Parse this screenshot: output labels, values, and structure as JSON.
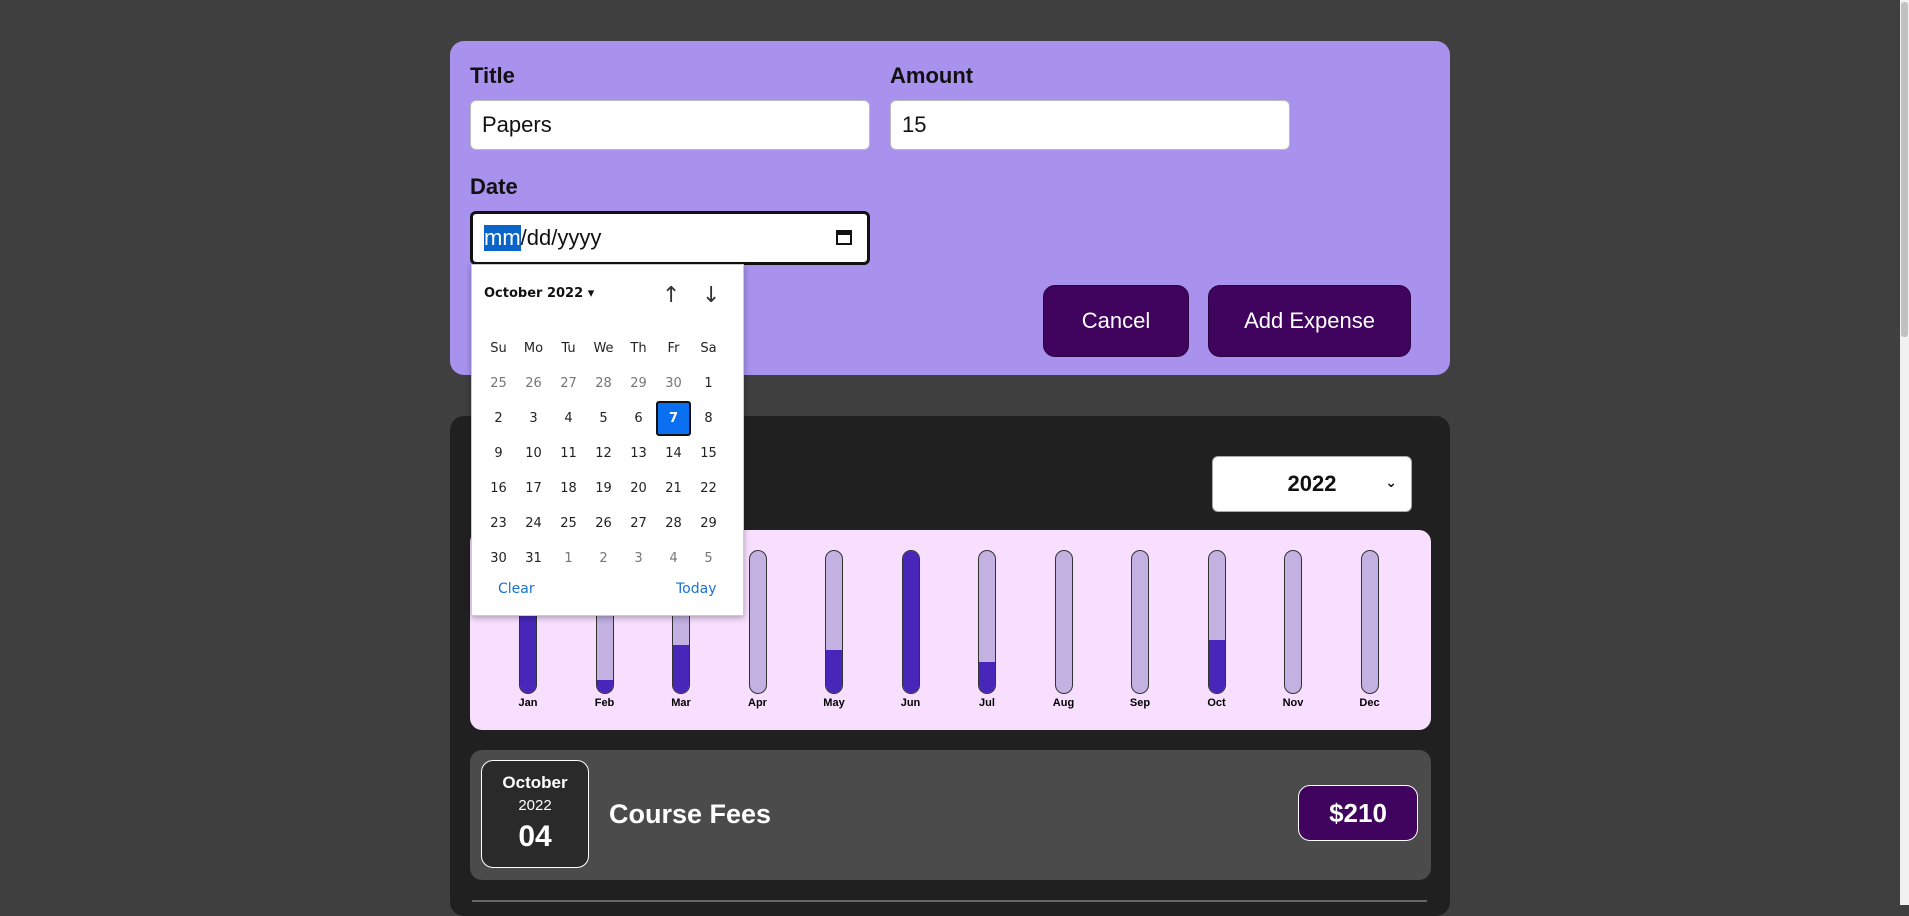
{
  "form": {
    "title_label": "Title",
    "title_value": "Papers",
    "amount_label": "Amount",
    "amount_value": "15",
    "date_label": "Date",
    "date_mm": "mm",
    "date_rest": "/dd/yyyy",
    "cancel_label": "Cancel",
    "add_label": "Add Expense"
  },
  "calendar": {
    "month_label": "October 2022",
    "weekdays": [
      "Su",
      "Mo",
      "Tu",
      "We",
      "Th",
      "Fr",
      "Sa"
    ],
    "weeks": [
      [
        "25",
        "26",
        "27",
        "28",
        "29",
        "30",
        "1"
      ],
      [
        "2",
        "3",
        "4",
        "5",
        "6",
        "7",
        "8"
      ],
      [
        "9",
        "10",
        "11",
        "12",
        "13",
        "14",
        "15"
      ],
      [
        "16",
        "17",
        "18",
        "19",
        "20",
        "21",
        "22"
      ],
      [
        "23",
        "24",
        "25",
        "26",
        "27",
        "28",
        "29"
      ],
      [
        "30",
        "31",
        "1",
        "2",
        "3",
        "4",
        "5"
      ]
    ],
    "selected_day": "7",
    "clear_label": "Clear",
    "today_label": "Today"
  },
  "filter": {
    "year_value": "2022"
  },
  "chart_data": {
    "type": "bar",
    "categories": [
      "Jan",
      "Feb",
      "Mar",
      "Apr",
      "May",
      "Jun",
      "Jul",
      "Aug",
      "Sep",
      "Oct",
      "Nov",
      "Dec"
    ],
    "values": [
      0.95,
      0.09,
      0.34,
      0.0,
      0.3,
      1.0,
      0.22,
      0.0,
      0.0,
      0.37,
      0.0,
      0.0
    ]
  },
  "expenses": [
    {
      "month": "October",
      "year": "2022",
      "day": "04",
      "title": "Course Fees",
      "amount": "$210"
    }
  ]
}
